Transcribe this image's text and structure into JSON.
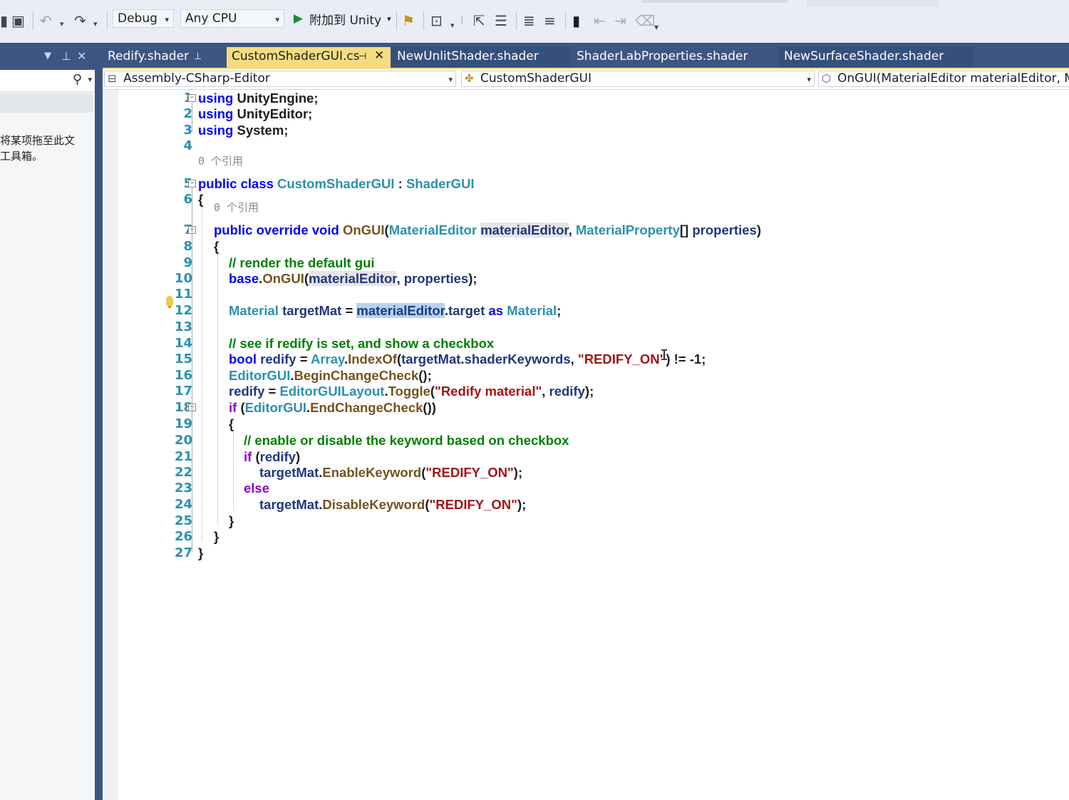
{
  "toolbar": {
    "config": "Debug",
    "platform": "Any CPU",
    "attach_label": "附加到 Unity"
  },
  "left_panel": {
    "hint": "将某项拖至此文\n工具箱。"
  },
  "tabs": [
    {
      "label": "Redify.shader",
      "active": false
    },
    {
      "label": "CustomShaderGUI.cs",
      "active": true
    },
    {
      "label": "NewUnlitShader.shader",
      "active": false
    },
    {
      "label": "ShaderLabProperties.shader",
      "active": false
    },
    {
      "label": "NewSurfaceShader.shader",
      "active": false
    }
  ],
  "navbar": {
    "project": "Assembly-CSharp-Editor",
    "type": "CustomShaderGUI",
    "member": "OnGUI(MaterialEditor materialEditor, Mate"
  },
  "editor": {
    "reference_lens": "0 个引用",
    "line_numbers": [
      "1",
      "2",
      "3",
      "4",
      "5",
      "6",
      "7",
      "8",
      "9",
      "10",
      "11",
      "12",
      "13",
      "14",
      "15",
      "16",
      "17",
      "18",
      "19",
      "20",
      "21",
      "22",
      "23",
      "24",
      "25",
      "26",
      "27"
    ],
    "lines": [
      [
        {
          "t": "using",
          "c": "kw"
        },
        {
          "t": " UnityEngine;"
        }
      ],
      [
        {
          "t": "using",
          "c": "kw"
        },
        {
          "t": " UnityEditor;"
        }
      ],
      [
        {
          "t": "using",
          "c": "kw"
        },
        {
          "t": " System;"
        }
      ],
      [],
      [
        {
          "t": "public class",
          "c": "kw"
        },
        {
          "t": " "
        },
        {
          "t": "CustomShaderGUI",
          "c": "ty"
        },
        {
          "t": " : "
        },
        {
          "t": "ShaderGUI",
          "c": "ty"
        }
      ],
      [
        {
          "t": "{"
        }
      ],
      [
        {
          "t": "public override void",
          "c": "kw"
        },
        {
          "t": " "
        },
        {
          "t": "OnGUI",
          "c": "fn"
        },
        {
          "t": "("
        },
        {
          "t": "MaterialEditor",
          "c": "ty"
        },
        {
          "t": " "
        },
        {
          "t": "materialEditor",
          "c": "pr hl"
        },
        {
          "t": ", "
        },
        {
          "t": "MaterialProperty",
          "c": "ty"
        },
        {
          "t": "[] "
        },
        {
          "t": "properties",
          "c": "pr"
        },
        {
          "t": ")"
        }
      ],
      [
        {
          "t": "{"
        }
      ],
      [
        {
          "t": "// render the default gui",
          "c": "cm"
        }
      ],
      [
        {
          "t": "base",
          "c": "kw"
        },
        {
          "t": "."
        },
        {
          "t": "OnGUI",
          "c": "fn"
        },
        {
          "t": "("
        },
        {
          "t": "materialEditor",
          "c": "pr hl"
        },
        {
          "t": ", "
        },
        {
          "t": "properties",
          "c": "pr"
        },
        {
          "t": ");"
        }
      ],
      [],
      [
        {
          "t": "Material",
          "c": "ty"
        },
        {
          "t": " "
        },
        {
          "t": "targetMat",
          "c": "pr"
        },
        {
          "t": " = "
        },
        {
          "t": "materialEditor",
          "c": "pr sel"
        },
        {
          "t": "."
        },
        {
          "t": "target",
          "c": "pr"
        },
        {
          "t": " "
        },
        {
          "t": "as",
          "c": "kw"
        },
        {
          "t": " "
        },
        {
          "t": "Material",
          "c": "ty"
        },
        {
          "t": ";"
        }
      ],
      [],
      [
        {
          "t": "// see if redify is set, and show a checkbox",
          "c": "cm"
        }
      ],
      [
        {
          "t": "bool",
          "c": "kw"
        },
        {
          "t": " "
        },
        {
          "t": "redify",
          "c": "pr"
        },
        {
          "t": " = "
        },
        {
          "t": "Array",
          "c": "ty"
        },
        {
          "t": "."
        },
        {
          "t": "IndexOf",
          "c": "fn"
        },
        {
          "t": "("
        },
        {
          "t": "targetMat",
          "c": "pr"
        },
        {
          "t": "."
        },
        {
          "t": "shaderKeywords",
          "c": "pr"
        },
        {
          "t": ", "
        },
        {
          "t": "\"REDIFY_ON\"",
          "c": "st"
        },
        {
          "t": ") != -1;"
        }
      ],
      [
        {
          "t": "EditorGUI",
          "c": "ty"
        },
        {
          "t": "."
        },
        {
          "t": "BeginChangeCheck",
          "c": "fn"
        },
        {
          "t": "();"
        }
      ],
      [
        {
          "t": "redify",
          "c": "pr"
        },
        {
          "t": " = "
        },
        {
          "t": "EditorGUILayout",
          "c": "ty"
        },
        {
          "t": "."
        },
        {
          "t": "Toggle",
          "c": "fn"
        },
        {
          "t": "("
        },
        {
          "t": "\"Redify material\"",
          "c": "st"
        },
        {
          "t": ", "
        },
        {
          "t": "redify",
          "c": "pr"
        },
        {
          "t": ");"
        }
      ],
      [
        {
          "t": "if",
          "c": "ct"
        },
        {
          "t": " ("
        },
        {
          "t": "EditorGUI",
          "c": "ty"
        },
        {
          "t": "."
        },
        {
          "t": "EndChangeCheck",
          "c": "fn"
        },
        {
          "t": "())"
        }
      ],
      [
        {
          "t": "{"
        }
      ],
      [
        {
          "t": "// enable or disable the keyword based on checkbox",
          "c": "cm"
        }
      ],
      [
        {
          "t": "if",
          "c": "ct"
        },
        {
          "t": " ("
        },
        {
          "t": "redify",
          "c": "pr"
        },
        {
          "t": ")"
        }
      ],
      [
        {
          "t": "targetMat",
          "c": "pr"
        },
        {
          "t": "."
        },
        {
          "t": "EnableKeyword",
          "c": "fn"
        },
        {
          "t": "("
        },
        {
          "t": "\"REDIFY_ON\"",
          "c": "st"
        },
        {
          "t": ");"
        }
      ],
      [
        {
          "t": "else",
          "c": "ct"
        }
      ],
      [
        {
          "t": "targetMat",
          "c": "pr"
        },
        {
          "t": "."
        },
        {
          "t": "DisableKeyword",
          "c": "fn"
        },
        {
          "t": "("
        },
        {
          "t": "\"REDIFY_ON\"",
          "c": "st"
        },
        {
          "t": ");"
        }
      ],
      [
        {
          "t": "}"
        }
      ],
      [
        {
          "t": "}"
        }
      ],
      [
        {
          "t": "}"
        }
      ]
    ]
  }
}
